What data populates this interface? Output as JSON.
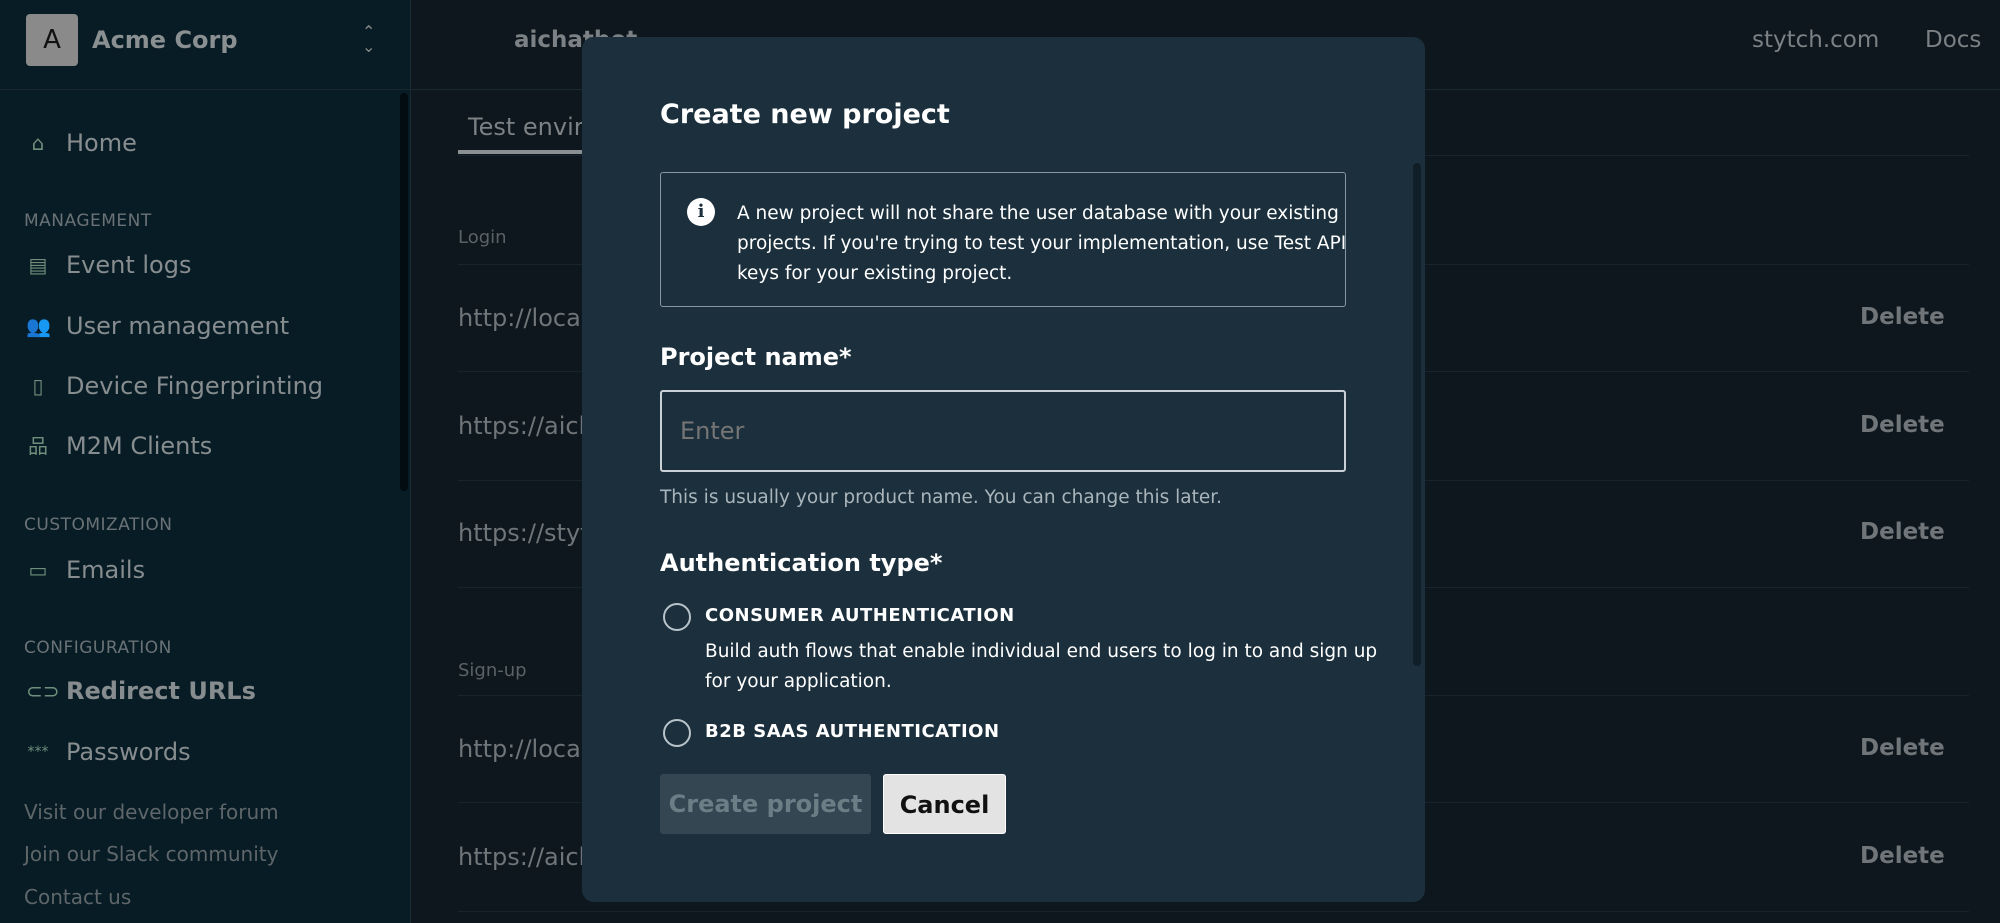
{
  "org": {
    "initial": "A",
    "name": "Acme Corp"
  },
  "header": {
    "project": "aichatbot",
    "links": [
      "stytch.com",
      "Docs"
    ]
  },
  "sidebar": {
    "home": "Home",
    "sections": [
      {
        "title": "MANAGEMENT",
        "items": [
          "Event logs",
          "User management",
          "Device Fingerprinting",
          "M2M Clients"
        ]
      },
      {
        "title": "CUSTOMIZATION",
        "items": [
          "Emails"
        ]
      },
      {
        "title": "CONFIGURATION",
        "items": [
          "Redirect URLs",
          "Passwords"
        ]
      }
    ],
    "active": "Redirect URLs",
    "footer": [
      "Visit our developer forum",
      "Join our Slack community",
      "Contact us"
    ]
  },
  "main": {
    "tab": "Test envir",
    "login_label": "Login",
    "login_rows": [
      {
        "url": "http://local",
        "action": "Delete"
      },
      {
        "url": "https://aich",
        "action": "Delete"
      },
      {
        "url": "https://styt",
        "action": "Delete"
      }
    ],
    "signup_label": "Sign-up",
    "signup_rows": [
      {
        "url": "http://local",
        "action": "Delete"
      },
      {
        "url": "https://aich",
        "action": "Delete"
      }
    ]
  },
  "modal": {
    "title": "Create new project",
    "info_lines": [
      "A new project will not share the user database with your existing",
      "projects. If you're trying to test your implementation, use Test API",
      "keys for your existing project."
    ],
    "name_label": "Project name*",
    "name_placeholder": "Enter",
    "name_value": "",
    "name_help": "This is usually your product name. You can change this later.",
    "auth_label": "Authentication type*",
    "options": [
      {
        "label": "CONSUMER AUTHENTICATION",
        "desc": [
          "Build auth flows that enable individual end users to log in to and sign up",
          "for your application."
        ],
        "selected": false
      },
      {
        "label": "B2B SAAS AUTHENTICATION",
        "selected": false
      }
    ],
    "create_label": "Create project",
    "cancel_label": "Cancel"
  },
  "colors": {
    "modal_bg": "#1b2f3c",
    "sidebar_bg": "#081c26",
    "icon": "#6f8f7c"
  }
}
